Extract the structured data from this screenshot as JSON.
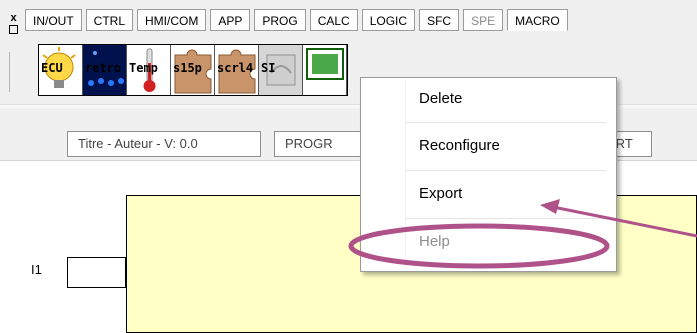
{
  "side_buttons": [
    "x",
    ""
  ],
  "tabs": [
    {
      "label": "IN/OUT",
      "state": "normal"
    },
    {
      "label": "CTRL",
      "state": "normal"
    },
    {
      "label": "HMI/COM",
      "state": "normal"
    },
    {
      "label": "APP",
      "state": "normal"
    },
    {
      "label": "PROG",
      "state": "normal"
    },
    {
      "label": "CALC",
      "state": "normal"
    },
    {
      "label": "LOGIC",
      "state": "normal"
    },
    {
      "label": "SFC",
      "state": "normal"
    },
    {
      "label": "SPE",
      "state": "disabled"
    },
    {
      "label": "MACRO",
      "state": "active"
    }
  ],
  "palette": [
    {
      "label": "ECU",
      "icon": "lightbulb-icon"
    },
    {
      "label": "retro",
      "icon": "led-strip-icon"
    },
    {
      "label": "Temp",
      "icon": "thermometer-icon"
    },
    {
      "label": "s15p",
      "icon": "puzzle-piece-icon"
    },
    {
      "label": "scrl4",
      "icon": "puzzle-piece-icon"
    },
    {
      "label": "SI",
      "icon": "macro-block-icon"
    },
    {
      "label": "",
      "icon": "fbd-block-icon"
    }
  ],
  "title_fields": {
    "author": "Titre - Auteur - V: 0.0",
    "program": "PROGR",
    "mode": "ART"
  },
  "diagram": {
    "input_label": "I1"
  },
  "context_menu": {
    "items": [
      {
        "label": "Delete",
        "enabled": true
      },
      {
        "label": "Reconfigure",
        "enabled": true
      },
      {
        "label": "Export",
        "enabled": true
      },
      {
        "label": "Help",
        "enabled": false
      }
    ]
  },
  "colors": {
    "annotation": "#b0528a",
    "diagram_fill": "#ffffc6",
    "toolbar_bg": "#f0f0f0"
  }
}
